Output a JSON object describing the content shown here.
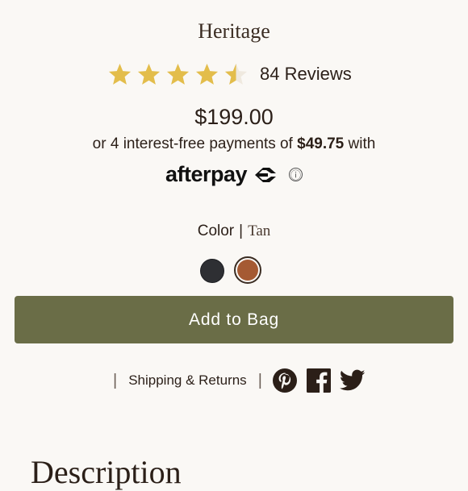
{
  "product": {
    "title": "Heritage",
    "rating": 4.5,
    "rating_max": 5,
    "reviews_label": "84 Reviews",
    "price": "$199.00",
    "installment_prefix": "or 4 interest-free payments of",
    "installment_amount": "$49.75",
    "installment_suffix": "with",
    "afterpay_label": "afterpay",
    "afterpay_info_icon": "ⓘ"
  },
  "color": {
    "label": "Color",
    "separator": "|",
    "selected": "Tan",
    "swatches": [
      {
        "name": "Black",
        "hex": "#2e2f33",
        "selected": false
      },
      {
        "name": "Tan",
        "hex": "#a55a33",
        "selected": true
      }
    ]
  },
  "actions": {
    "add_to_bag": "Add to Bag"
  },
  "links": {
    "separator": "|",
    "shipping_returns": "Shipping & Returns",
    "social_icons": [
      "pinterest-icon",
      "facebook-icon",
      "twitter-icon"
    ]
  },
  "sections": {
    "description_heading": "Description"
  },
  "colors": {
    "star": "#e3bd4b",
    "star_empty": "#efe9df",
    "button_bg": "#6a6d47",
    "text": "#2b1f18",
    "background": "#faf8f5"
  }
}
